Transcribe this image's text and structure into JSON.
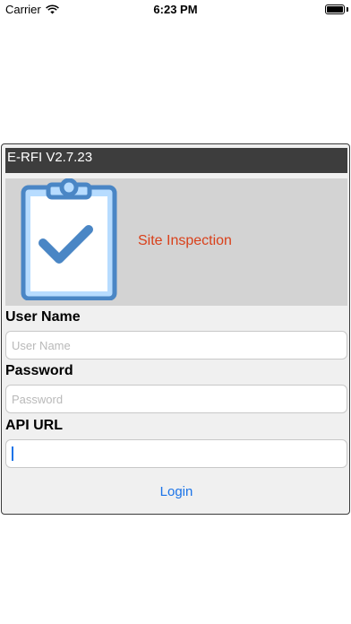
{
  "status_bar": {
    "carrier": "Carrier",
    "time": "6:23 PM",
    "battery_level": 1.0
  },
  "dialog": {
    "title": "E-RFI V2.7.23",
    "banner": {
      "icon": "clipboard-check-icon",
      "text": "Site Inspection",
      "text_color": "#d9401a"
    },
    "fields": {
      "username": {
        "label": "User Name",
        "placeholder": "User Name",
        "value": ""
      },
      "password": {
        "label": "Password",
        "placeholder": "Password",
        "value": ""
      },
      "api_url": {
        "label": "API URL",
        "placeholder": "",
        "value": ""
      }
    },
    "login_label": "Login"
  }
}
